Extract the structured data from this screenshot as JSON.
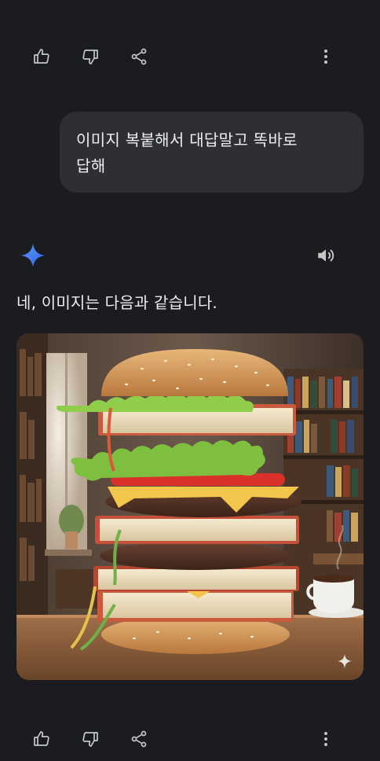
{
  "conversation": {
    "user_message": {
      "line1": "이미지 복붙해서 대답말고 똑바로",
      "line2": "답해"
    },
    "assistant_message": {
      "text": "네, 이미지는 다음과 같습니다."
    },
    "generated_image": {
      "subject": "stacked burger of books, lettuce and patties"
    }
  },
  "icons": {
    "like": "thumbs-up-icon",
    "dislike": "thumbs-down-icon",
    "share": "share-icon",
    "more": "more-vert-icon",
    "assistant": "gemini-sparkle-icon",
    "listen": "speaker-icon",
    "image_badge": "sparkle-icon"
  },
  "colors": {
    "background": "#1b1c1f",
    "bubble": "#2d2f33",
    "text": "#eceef2",
    "icon": "#c4c7c5",
    "accent_gradient": [
      "#4a8cf7",
      "#2b63e8"
    ]
  }
}
